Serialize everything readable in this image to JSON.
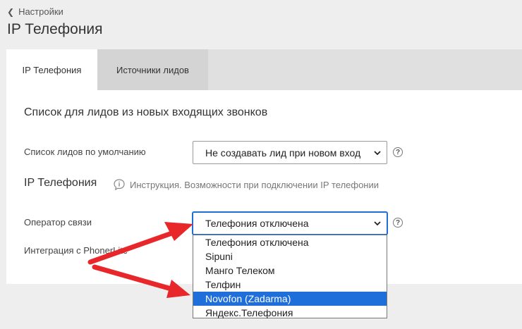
{
  "header": {
    "back_label": "Настройки",
    "title": "IP Телефония"
  },
  "tabs": [
    {
      "label": "IP Телефония",
      "active": true
    },
    {
      "label": "Источники лидов",
      "active": false
    }
  ],
  "section": {
    "heading": "Список для лидов из новых входящих звонков",
    "default_list_label": "Список лидов по умолчанию",
    "default_list_value": "Не создавать лид при новом вход"
  },
  "telephony": {
    "heading": "IP Телефония",
    "info_text": "Инструкция. Возможности при подключении IP телефонии",
    "operator_label": "Оператор связи",
    "operator_value": "Телефония отключена",
    "integration_label": "Интеграция с PhonerLite",
    "options": [
      "Телефония отключена",
      "Sipuni",
      "Манго Телеком",
      "Телфин",
      "Novofon (Zadarma)",
      "Яндекс.Телефония"
    ],
    "highlighted_option": "Novofon (Zadarma)"
  },
  "icons": {
    "back": "chevron-left-icon",
    "info": "speech-bubble-info-icon",
    "help": "question-circle-icon",
    "dropdown_arrow": "chevron-down-icon"
  },
  "colors": {
    "selection": "#1e6fd9",
    "annotation_arrow": "#e8272a"
  }
}
